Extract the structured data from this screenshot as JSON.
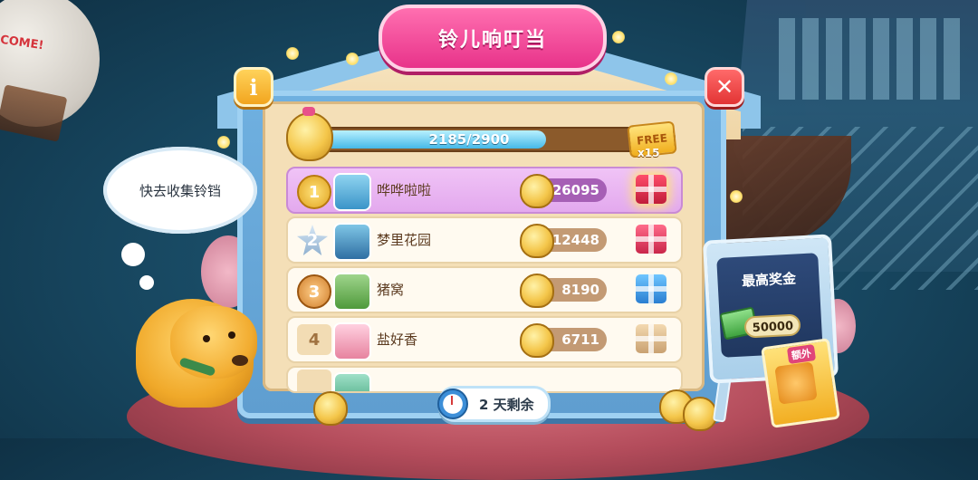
{
  "title": "铃儿响叮当",
  "info_button": "i",
  "close_button": "✕",
  "progress": {
    "text": "2185/2900",
    "current": 2185,
    "max": 2900,
    "free_label": "FREE",
    "free_count": "x15"
  },
  "leaderboard": [
    {
      "rank": "1",
      "name": "哗哗啦啦",
      "score": "26095",
      "gift": "red-gift-icon"
    },
    {
      "rank": "2",
      "name": "梦里花园",
      "score": "12448",
      "gift": "pink-gift-icon"
    },
    {
      "rank": "3",
      "name": "猪窝",
      "score": "8190",
      "gift": "blue-gift-icon"
    },
    {
      "rank": "4",
      "name": "盐好香",
      "score": "6711",
      "gift": "tan-gift-icon"
    }
  ],
  "timer": {
    "text": "2 天剩余",
    "icon": "clock-icon"
  },
  "speech_bubble": "快去收集铃铛",
  "reward": {
    "title": "最高奖金",
    "cash": "50000",
    "extra_label": "额外"
  },
  "background": {
    "balloon_text": "COME!"
  },
  "colors": {
    "title_pink": "#e8338a",
    "board_blue": "#6fb0e0",
    "first_row": "#e3a9ee",
    "progress_fill": "#45b9e8"
  }
}
